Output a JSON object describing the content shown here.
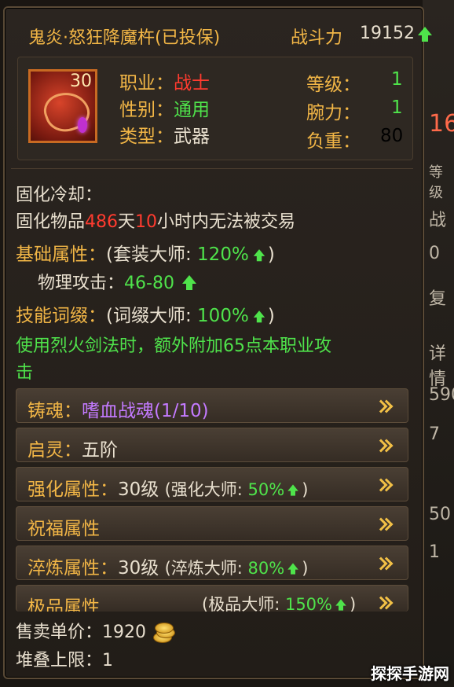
{
  "header": {
    "item_name": "鬼炎·怒狂降魔杵(已投保)",
    "power_label": "战斗力",
    "power_value": "19152"
  },
  "item": {
    "level_badge": "30",
    "icon": "demon-pestle-weapon-icon"
  },
  "stats_left": [
    {
      "key": "职业",
      "sep": "：",
      "value": "战士"
    },
    {
      "key": "性别",
      "sep": "：",
      "value": "通用"
    },
    {
      "key": "类型",
      "sep": "：",
      "value": "武器"
    }
  ],
  "stats_right": [
    {
      "key": "等级",
      "sep": "：",
      "value": "1"
    },
    {
      "key": "腕力",
      "sep": "：",
      "value": "1"
    },
    {
      "key": "负重",
      "sep": "：",
      "value": "80"
    }
  ],
  "details": {
    "cooldown_label": "固化冷却：",
    "lock_prefix": "固化物品",
    "lock_days": "486",
    "lock_days_unit": "天",
    "lock_hours": "10",
    "lock_suffix": "小时内无法被交易",
    "base_attr_label": "基础属性：",
    "base_attr_master_open": "(套装大师: ",
    "base_attr_master_val": "120%",
    "base_attr_master_close": ")",
    "phys_atk_label": "物理攻击：",
    "phys_atk_value": "46-80",
    "skill_label": "技能词缀：",
    "skill_master_open": "(词缀大师: ",
    "skill_master_val": "100%",
    "skill_master_close": ")",
    "skill_desc_line1": "使用烈火剑法时，额外附加65点本职业攻",
    "skill_desc_line2": "击"
  },
  "rows": [
    {
      "label": "铸魂：",
      "value": "嗜血战魂(1/10)"
    },
    {
      "label": "启灵：",
      "value": "五阶"
    },
    {
      "label": "强化属性：",
      "value": "30级",
      "master_open": "(强化大师: ",
      "master_val": "50%",
      "master_close": ")"
    },
    {
      "label": "祝福属性"
    },
    {
      "label": "淬炼属性：",
      "value": "30级",
      "master_open": "(淬炼大师: ",
      "master_val": "80%",
      "master_close": ")"
    },
    {
      "label": "极品属性",
      "master_open": "(极品大师: ",
      "master_val": "150%",
      "master_close": ")"
    }
  ],
  "footer": {
    "price_label": "售卖单价：",
    "price_value": "1920",
    "stack_label": "堆叠上限：",
    "stack_value": "1"
  },
  "background": {
    "frag1": "16",
    "frag2": "等级",
    "frag3": "战",
    "frag4": "0",
    "frag5": "复",
    "frag6": "详情",
    "frag7": "590",
    "frag8": "7",
    "frag9": "50",
    "frag10": "1"
  },
  "watermark": "探探手游网",
  "colors": {
    "gold": "#f2b646",
    "green": "#4fe34b",
    "red": "#ff3b2f",
    "purple": "#c37aff",
    "text": "#e9e0cf"
  }
}
